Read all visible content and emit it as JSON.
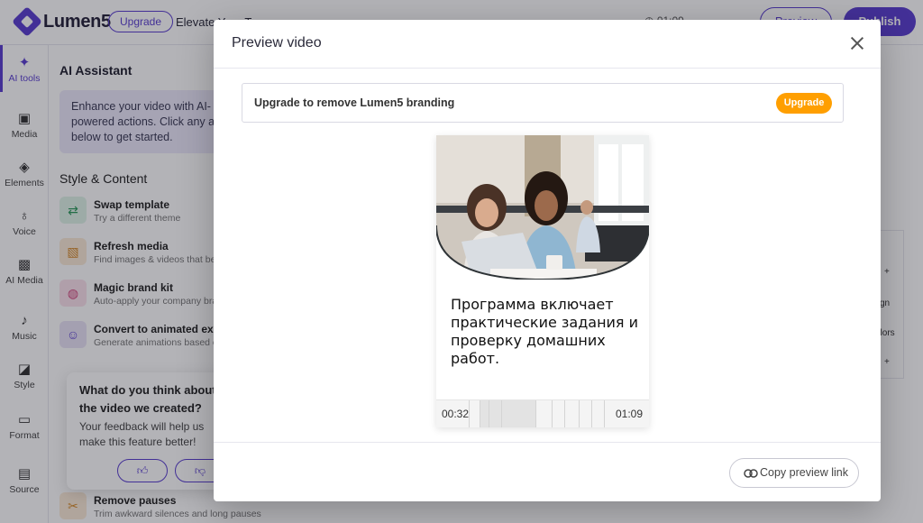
{
  "app": {
    "logo_text": "Lumen5",
    "upgrade_label": "Upgrade",
    "project_title": "Elevate Your T",
    "time_text": "01:09",
    "preview_label": "Preview",
    "publish_label": "Publish",
    "brand_color": "#5a3fd0"
  },
  "nav": {
    "items": [
      {
        "label": "AI tools",
        "icon": "magic-wand-icon"
      },
      {
        "label": "Media",
        "icon": "image-icon"
      },
      {
        "label": "Elements",
        "icon": "shapes-icon"
      },
      {
        "label": "Voice",
        "icon": "microphone-icon"
      },
      {
        "label": "AI Media",
        "icon": "ai-image-icon"
      },
      {
        "label": "Music",
        "icon": "music-note-icon"
      },
      {
        "label": "Style",
        "icon": "brush-icon"
      },
      {
        "label": "Format",
        "icon": "format-icon"
      },
      {
        "label": "Source",
        "icon": "document-icon"
      }
    ]
  },
  "panel": {
    "title": "AI Assistant",
    "info": "Enhance your video with AI-powered actions. Click any action below to get started.",
    "section": "Style & Content",
    "actions": [
      {
        "title": "Swap template",
        "desc": "Try a different theme"
      },
      {
        "title": "Refresh media",
        "desc": "Find images & videos that better fit"
      },
      {
        "title": "Magic brand kit",
        "desc": "Auto-apply your company brand"
      },
      {
        "title": "Convert to animated explainer",
        "desc": "Generate animations based on content"
      },
      {
        "title": "Remove pauses",
        "desc": "Trim awkward silences and long pauses"
      }
    ]
  },
  "feedback": {
    "title": "What do you think about the video we created?",
    "subtitle": "Your feedback will help us make this feature better!"
  },
  "right_rail": {
    "items": [
      "+",
      "gn",
      "olors",
      "+"
    ]
  },
  "modal": {
    "title": "Preview video",
    "upgrade_text": "Upgrade to remove Lumen5 branding",
    "upgrade_button": "Upgrade",
    "upgrade_color": "#ff9f00",
    "caption": "Программа включает практические задания и проверку домашних работ.",
    "time_current": "00:32",
    "time_total": "01:09",
    "copy_link_label": "Copy preview link"
  }
}
